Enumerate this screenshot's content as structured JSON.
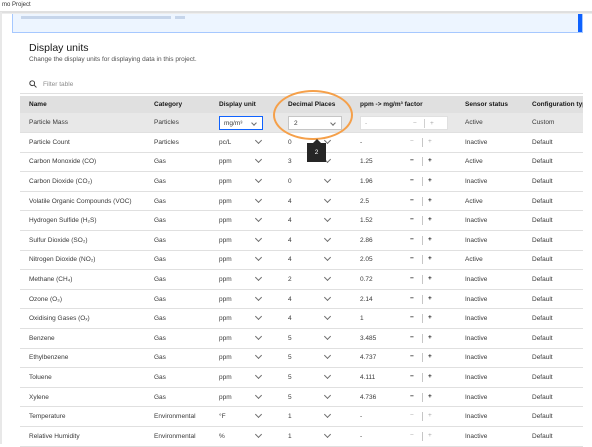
{
  "window": {
    "title": "mo Project"
  },
  "page": {
    "title": "Display units",
    "subtitle": "Change the display units for displaying data in this project."
  },
  "filter": {
    "placeholder": "Filter table",
    "icon": "search-icon"
  },
  "columns": [
    "Name",
    "Category",
    "Display unit",
    "Decimal Places",
    "ppm -> mg/m³ factor",
    "Sensor status",
    "Configuration type"
  ],
  "tooltip": {
    "value": "2"
  },
  "accent_colors": {
    "focus": "#0f62fe",
    "highlight": "#f5a04a",
    "header": "#e0e0e0"
  },
  "rows": [
    {
      "name": "Particle Mass",
      "category": "Particles",
      "unit": "mg/m³",
      "decimals": "2",
      "factor": "-",
      "status": "Active",
      "config": "Custom"
    },
    {
      "name": "Particle Count",
      "category": "Particles",
      "unit": "pc/L",
      "decimals": "0",
      "factor": "-",
      "status": "Inactive",
      "config": "Default"
    },
    {
      "name": "Carbon Monoxide (CO)",
      "category": "Gas",
      "unit": "ppm",
      "decimals": "3",
      "factor": "1.25",
      "status": "Active",
      "config": "Default"
    },
    {
      "name": "Carbon Dioxide (CO₂)",
      "category": "Gas",
      "unit": "ppm",
      "decimals": "0",
      "factor": "1.96",
      "status": "Inactive",
      "config": "Default"
    },
    {
      "name": "Volatile Organic Compounds (VOC)",
      "category": "Gas",
      "unit": "ppm",
      "decimals": "4",
      "factor": "2.5",
      "status": "Active",
      "config": "Default"
    },
    {
      "name": "Hydrogen Sulfide (H₂S)",
      "category": "Gas",
      "unit": "ppm",
      "decimals": "4",
      "factor": "1.52",
      "status": "Inactive",
      "config": "Default"
    },
    {
      "name": "Sulfur Dioxide (SO₂)",
      "category": "Gas",
      "unit": "ppm",
      "decimals": "4",
      "factor": "2.86",
      "status": "Inactive",
      "config": "Default"
    },
    {
      "name": "Nitrogen Dioxide (NO₂)",
      "category": "Gas",
      "unit": "ppm",
      "decimals": "4",
      "factor": "2.05",
      "status": "Active",
      "config": "Default"
    },
    {
      "name": "Methane (CH₄)",
      "category": "Gas",
      "unit": "ppm",
      "decimals": "2",
      "factor": "0.72",
      "status": "Inactive",
      "config": "Default"
    },
    {
      "name": "Ozone (O₃)",
      "category": "Gas",
      "unit": "ppm",
      "decimals": "4",
      "factor": "2.14",
      "status": "Inactive",
      "config": "Default"
    },
    {
      "name": "Oxidising Gases (Oₓ)",
      "category": "Gas",
      "unit": "ppm",
      "decimals": "4",
      "factor": "1",
      "status": "Inactive",
      "config": "Default"
    },
    {
      "name": "Benzene",
      "category": "Gas",
      "unit": "ppm",
      "decimals": "5",
      "factor": "3.485",
      "status": "Inactive",
      "config": "Default"
    },
    {
      "name": "Ethylbenzene",
      "category": "Gas",
      "unit": "ppm",
      "decimals": "5",
      "factor": "4.737",
      "status": "Inactive",
      "config": "Default"
    },
    {
      "name": "Toluene",
      "category": "Gas",
      "unit": "ppm",
      "decimals": "5",
      "factor": "4.111",
      "status": "Inactive",
      "config": "Default"
    },
    {
      "name": "Xylene",
      "category": "Gas",
      "unit": "ppm",
      "decimals": "5",
      "factor": "4.736",
      "status": "Inactive",
      "config": "Default"
    },
    {
      "name": "Temperature",
      "category": "Environmental",
      "unit": "°F",
      "decimals": "1",
      "factor": "-",
      "status": "Inactive",
      "config": "Default"
    },
    {
      "name": "Relative Humidity",
      "category": "Environmental",
      "unit": "%",
      "decimals": "1",
      "factor": "-",
      "status": "Inactive",
      "config": "Default"
    }
  ]
}
